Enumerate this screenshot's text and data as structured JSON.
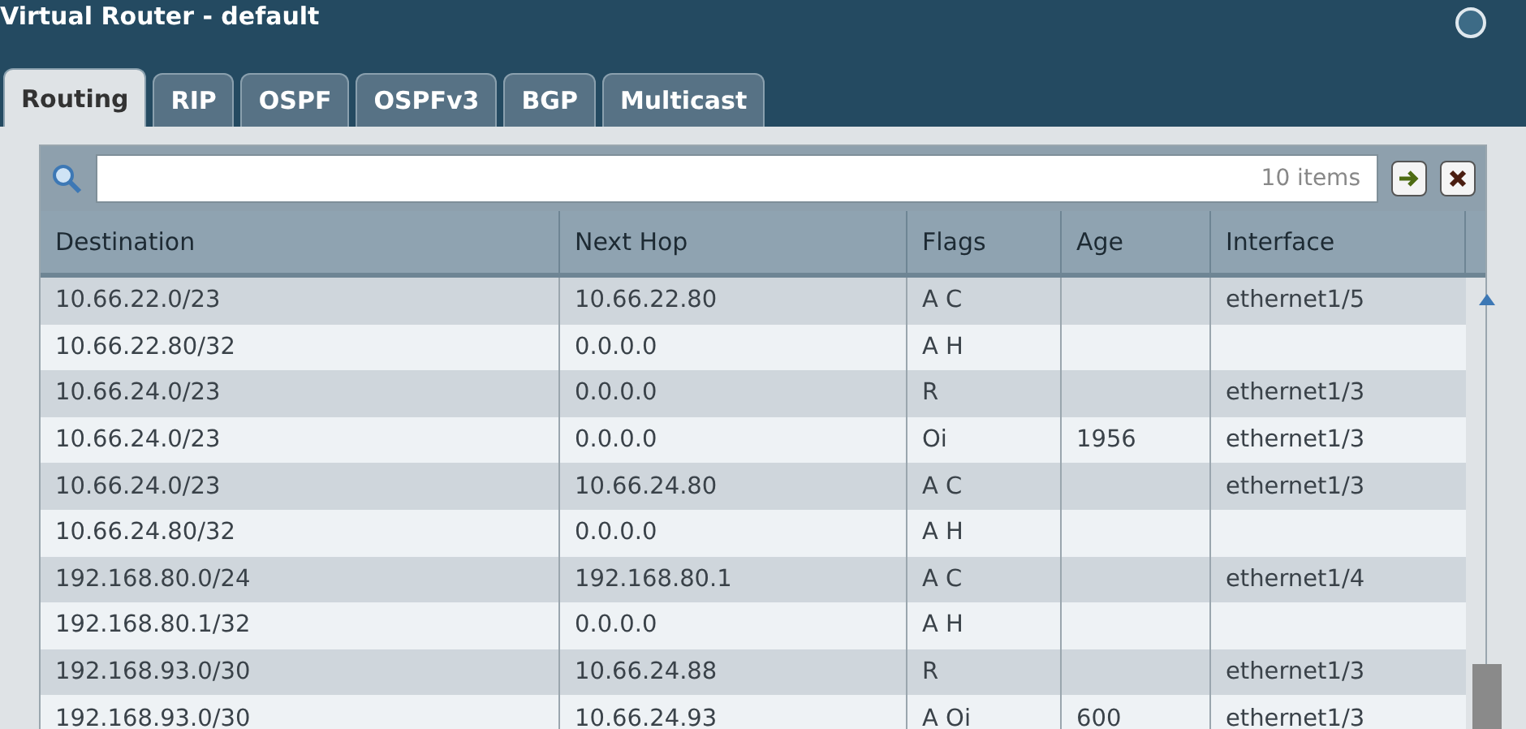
{
  "window": {
    "title": "Virtual Router - default"
  },
  "tabs": [
    {
      "label": "Routing",
      "selected": true
    },
    {
      "label": "RIP",
      "selected": false
    },
    {
      "label": "OSPF",
      "selected": false
    },
    {
      "label": "OSPFv3",
      "selected": false
    },
    {
      "label": "BGP",
      "selected": false
    },
    {
      "label": "Multicast",
      "selected": false
    }
  ],
  "search": {
    "count": "10 items"
  },
  "table": {
    "columns": [
      "Destination",
      "Next Hop",
      "Flags",
      "Age",
      "Interface"
    ],
    "rows": [
      [
        "10.66.22.0/23",
        "10.66.22.80",
        "A C",
        "",
        "ethernet1/5"
      ],
      [
        "10.66.22.80/32",
        "0.0.0.0",
        "A H",
        "",
        ""
      ],
      [
        "10.66.24.0/23",
        "0.0.0.0",
        "R",
        "",
        "ethernet1/3"
      ],
      [
        "10.66.24.0/23",
        "0.0.0.0",
        "Oi",
        "1956",
        "ethernet1/3"
      ],
      [
        "10.66.24.0/23",
        "10.66.24.80",
        "A C",
        "",
        "ethernet1/3"
      ],
      [
        "10.66.24.80/32",
        "0.0.0.0",
        "A H",
        "",
        ""
      ],
      [
        "192.168.80.0/24",
        "192.168.80.1",
        "A C",
        "",
        "ethernet1/4"
      ],
      [
        "192.168.80.1/32",
        "0.0.0.0",
        "A H",
        "",
        ""
      ],
      [
        "192.168.93.0/30",
        "10.66.24.88",
        "R",
        "",
        "ethernet1/3"
      ],
      [
        "192.168.93.0/30",
        "10.66.24.93",
        "A Oi",
        "600",
        "ethernet1/3"
      ]
    ]
  }
}
